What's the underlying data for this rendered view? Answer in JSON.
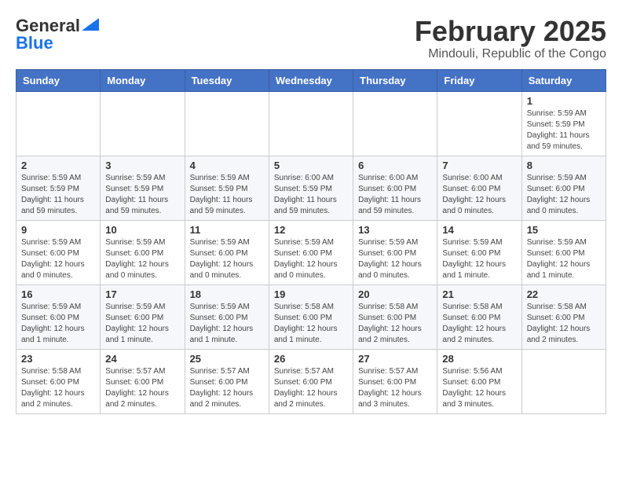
{
  "header": {
    "logo_line1": "General",
    "logo_line2": "Blue",
    "month": "February 2025",
    "location": "Mindouli, Republic of the Congo"
  },
  "weekdays": [
    "Sunday",
    "Monday",
    "Tuesday",
    "Wednesday",
    "Thursday",
    "Friday",
    "Saturday"
  ],
  "weeks": [
    [
      {
        "day": "",
        "info": ""
      },
      {
        "day": "",
        "info": ""
      },
      {
        "day": "",
        "info": ""
      },
      {
        "day": "",
        "info": ""
      },
      {
        "day": "",
        "info": ""
      },
      {
        "day": "",
        "info": ""
      },
      {
        "day": "1",
        "info": "Sunrise: 5:59 AM\nSunset: 5:59 PM\nDaylight: 11 hours\nand 59 minutes."
      }
    ],
    [
      {
        "day": "2",
        "info": "Sunrise: 5:59 AM\nSunset: 5:59 PM\nDaylight: 11 hours\nand 59 minutes."
      },
      {
        "day": "3",
        "info": "Sunrise: 5:59 AM\nSunset: 5:59 PM\nDaylight: 11 hours\nand 59 minutes."
      },
      {
        "day": "4",
        "info": "Sunrise: 5:59 AM\nSunset: 5:59 PM\nDaylight: 11 hours\nand 59 minutes."
      },
      {
        "day": "5",
        "info": "Sunrise: 6:00 AM\nSunset: 5:59 PM\nDaylight: 11 hours\nand 59 minutes."
      },
      {
        "day": "6",
        "info": "Sunrise: 6:00 AM\nSunset: 6:00 PM\nDaylight: 11 hours\nand 59 minutes."
      },
      {
        "day": "7",
        "info": "Sunrise: 6:00 AM\nSunset: 6:00 PM\nDaylight: 12 hours\nand 0 minutes."
      },
      {
        "day": "8",
        "info": "Sunrise: 5:59 AM\nSunset: 6:00 PM\nDaylight: 12 hours\nand 0 minutes."
      }
    ],
    [
      {
        "day": "9",
        "info": "Sunrise: 5:59 AM\nSunset: 6:00 PM\nDaylight: 12 hours\nand 0 minutes."
      },
      {
        "day": "10",
        "info": "Sunrise: 5:59 AM\nSunset: 6:00 PM\nDaylight: 12 hours\nand 0 minutes."
      },
      {
        "day": "11",
        "info": "Sunrise: 5:59 AM\nSunset: 6:00 PM\nDaylight: 12 hours\nand 0 minutes."
      },
      {
        "day": "12",
        "info": "Sunrise: 5:59 AM\nSunset: 6:00 PM\nDaylight: 12 hours\nand 0 minutes."
      },
      {
        "day": "13",
        "info": "Sunrise: 5:59 AM\nSunset: 6:00 PM\nDaylight: 12 hours\nand 0 minutes."
      },
      {
        "day": "14",
        "info": "Sunrise: 5:59 AM\nSunset: 6:00 PM\nDaylight: 12 hours\nand 1 minute."
      },
      {
        "day": "15",
        "info": "Sunrise: 5:59 AM\nSunset: 6:00 PM\nDaylight: 12 hours\nand 1 minute."
      }
    ],
    [
      {
        "day": "16",
        "info": "Sunrise: 5:59 AM\nSunset: 6:00 PM\nDaylight: 12 hours\nand 1 minute."
      },
      {
        "day": "17",
        "info": "Sunrise: 5:59 AM\nSunset: 6:00 PM\nDaylight: 12 hours\nand 1 minute."
      },
      {
        "day": "18",
        "info": "Sunrise: 5:59 AM\nSunset: 6:00 PM\nDaylight: 12 hours\nand 1 minute."
      },
      {
        "day": "19",
        "info": "Sunrise: 5:58 AM\nSunset: 6:00 PM\nDaylight: 12 hours\nand 1 minute."
      },
      {
        "day": "20",
        "info": "Sunrise: 5:58 AM\nSunset: 6:00 PM\nDaylight: 12 hours\nand 2 minutes."
      },
      {
        "day": "21",
        "info": "Sunrise: 5:58 AM\nSunset: 6:00 PM\nDaylight: 12 hours\nand 2 minutes."
      },
      {
        "day": "22",
        "info": "Sunrise: 5:58 AM\nSunset: 6:00 PM\nDaylight: 12 hours\nand 2 minutes."
      }
    ],
    [
      {
        "day": "23",
        "info": "Sunrise: 5:58 AM\nSunset: 6:00 PM\nDaylight: 12 hours\nand 2 minutes."
      },
      {
        "day": "24",
        "info": "Sunrise: 5:57 AM\nSunset: 6:00 PM\nDaylight: 12 hours\nand 2 minutes."
      },
      {
        "day": "25",
        "info": "Sunrise: 5:57 AM\nSunset: 6:00 PM\nDaylight: 12 hours\nand 2 minutes."
      },
      {
        "day": "26",
        "info": "Sunrise: 5:57 AM\nSunset: 6:00 PM\nDaylight: 12 hours\nand 2 minutes."
      },
      {
        "day": "27",
        "info": "Sunrise: 5:57 AM\nSunset: 6:00 PM\nDaylight: 12 hours\nand 3 minutes."
      },
      {
        "day": "28",
        "info": "Sunrise: 5:56 AM\nSunset: 6:00 PM\nDaylight: 12 hours\nand 3 minutes."
      },
      {
        "day": "",
        "info": ""
      }
    ]
  ]
}
